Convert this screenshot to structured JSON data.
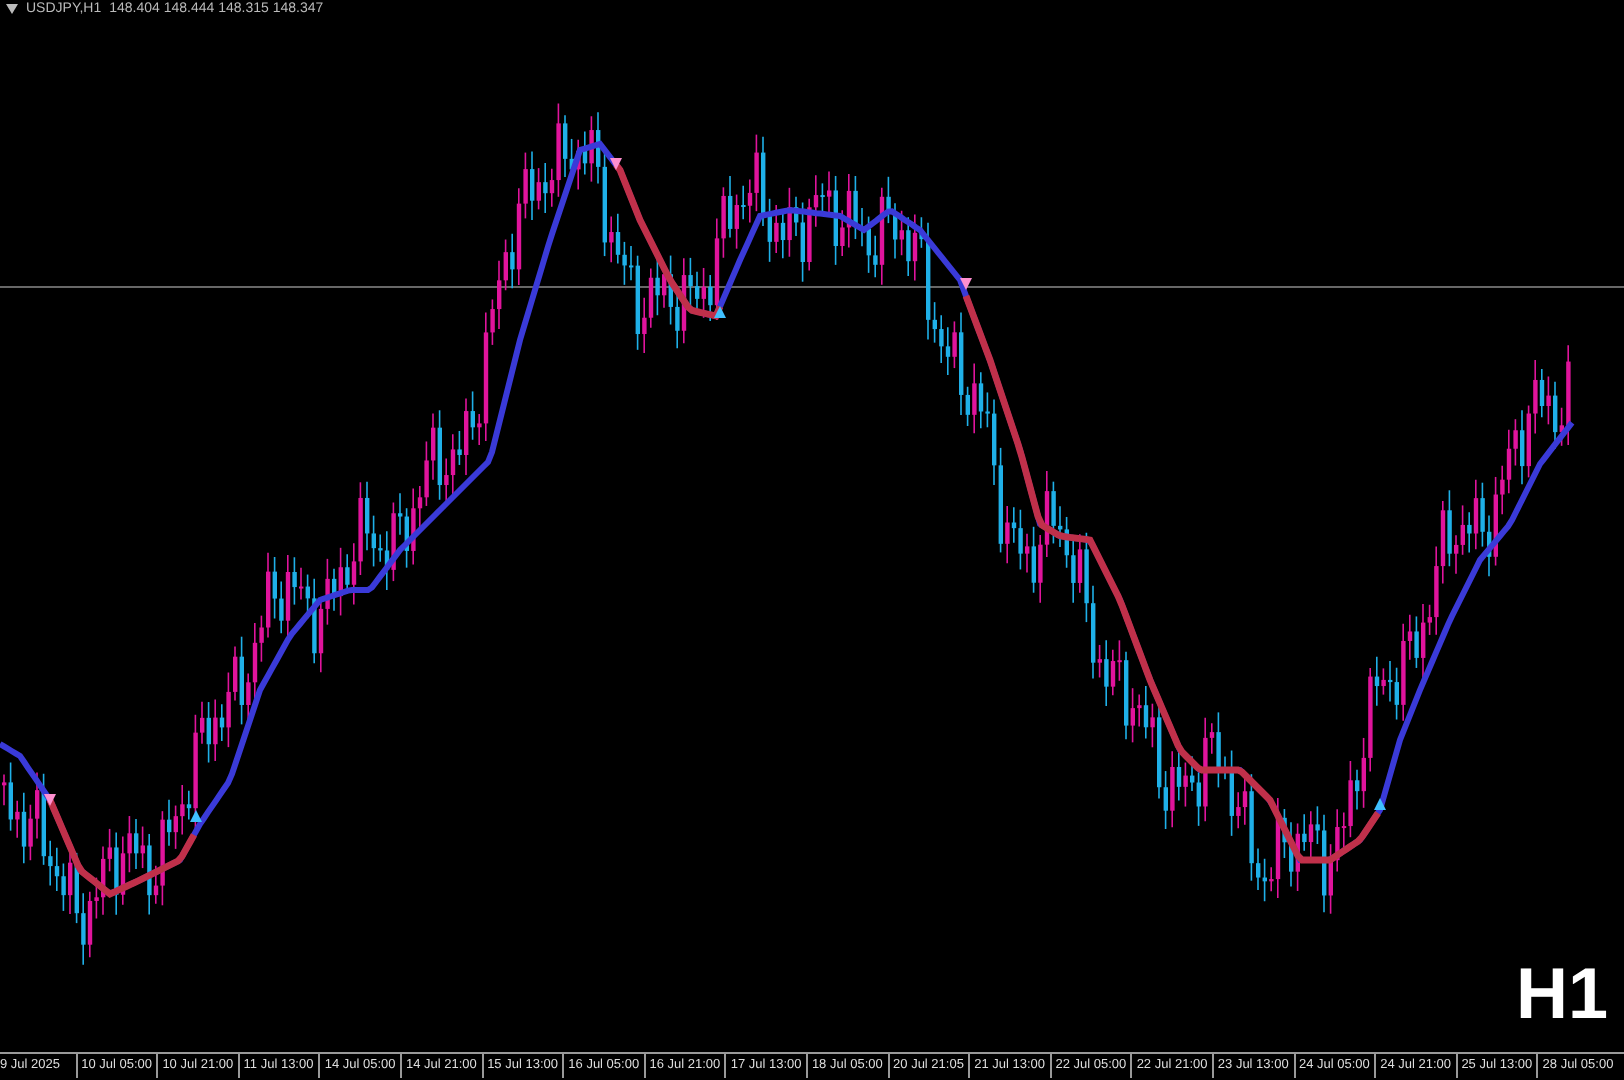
{
  "header": {
    "symbol": "USDJPY,H1",
    "prices": "148.404 148.444 148.315 148.347"
  },
  "timeframe_badge": "H1",
  "x_axis": {
    "labels": [
      "9 Jul 2025",
      "10 Jul 05:00",
      "10 Jul 21:00",
      "11 Jul 13:00",
      "14 Jul 05:00",
      "14 Jul 21:00",
      "15 Jul 13:00",
      "16 Jul 05:00",
      "16 Jul 21:00",
      "17 Jul 13:00",
      "18 Jul 05:00",
      "20 Jul 21:05",
      "21 Jul 13:00",
      "22 Jul 05:00",
      "22 Jul 21:00",
      "23 Jul 13:00",
      "24 Jul 05:00",
      "24 Jul 21:00",
      "25 Jul 13:00",
      "28 Jul 05:00"
    ]
  }
}
